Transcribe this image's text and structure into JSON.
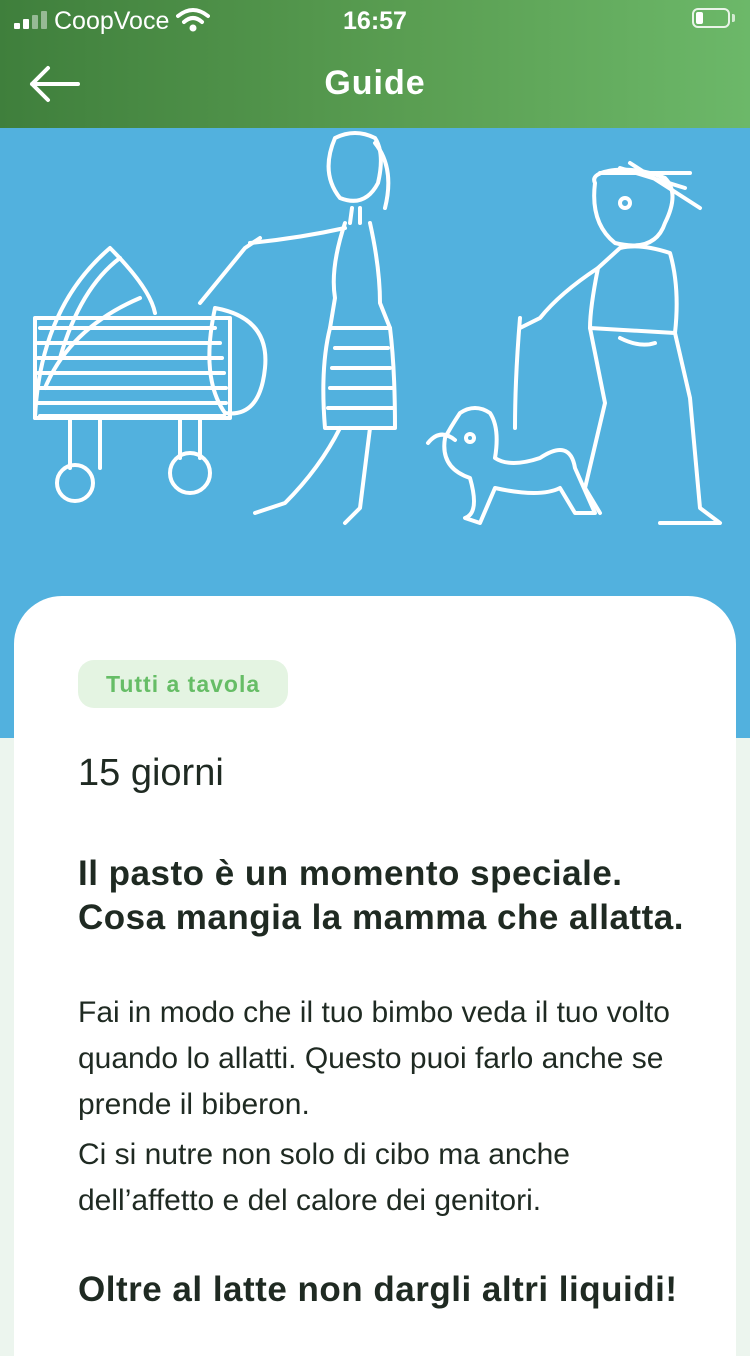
{
  "status_bar": {
    "carrier": "CoopVoce",
    "time": "16:57"
  },
  "nav": {
    "title": "Guide",
    "back_icon": "arrow-left-icon"
  },
  "hero": {
    "illustration": "child-drawing-family-with-stroller-and-dog",
    "background_color": "#52b1de"
  },
  "content": {
    "category": "Tutti a tavola",
    "days": "15 giorni",
    "sections": [
      {
        "title": "Il pasto è un momento speciale. Cosa mangia la mamma che allatta.",
        "paragraphs": [
          "Fai in modo che il tuo bimbo veda il tuo volto quando lo allatti. Questo puoi farlo anche se prende il biberon.",
          "Ci si nutre non solo di cibo ma anche dell’affetto e del calore dei genitori."
        ]
      },
      {
        "title": "Oltre al latte non dargli altri liquidi!"
      }
    ]
  },
  "colors": {
    "header_start": "#3f7f3c",
    "header_end": "#6cb869",
    "chip_bg": "#e4f4e2",
    "chip_text": "#66bd66",
    "text": "#1f2a22"
  }
}
